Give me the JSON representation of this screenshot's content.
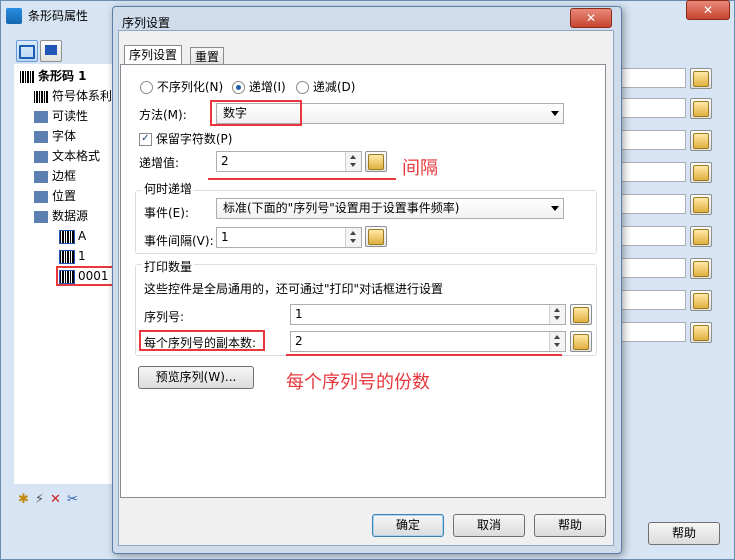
{
  "outer": {
    "title": "条形码属性",
    "tree": [
      {
        "label": "条形码 1",
        "icon": "barcode-icon",
        "bold": true
      },
      {
        "label": "符号体系利",
        "icon": "barcode-icon"
      },
      {
        "label": "可读性",
        "icon": "digits-icon"
      },
      {
        "label": "字体",
        "icon": "font-icon"
      },
      {
        "label": "文本格式",
        "icon": "text-format-icon"
      },
      {
        "label": "边框",
        "icon": "border-icon"
      },
      {
        "label": "位置",
        "icon": "position-icon"
      },
      {
        "label": "数据源",
        "icon": "datasource-icon"
      },
      {
        "label": "A",
        "icon": "barcode-source-icon"
      },
      {
        "label": "1",
        "icon": "barcode-source-icon"
      },
      {
        "label": "0001",
        "icon": "barcode-source-icon"
      }
    ],
    "help_button": "帮助",
    "close_glyph": "✕"
  },
  "dialog": {
    "title": "序列设置",
    "close_glyph": "✕",
    "tabs": [
      "序列设置",
      "重置"
    ],
    "radio_options": [
      "不序列化(N)",
      "递增(I)",
      "递减(D)"
    ],
    "method_label": "方法(M):",
    "method_value": "数字",
    "keep_chars_label": "保留字符数(P)",
    "increment_label": "递增值:",
    "increment_value": "2",
    "when_group_title": "何时递增",
    "event_label": "事件(E):",
    "event_value": "标准(下面的\"序列号\"设置用于设置事件频率)",
    "event_interval_label": "事件间隔(V):",
    "event_interval_value": "1",
    "print_group_title": "打印数量",
    "print_group_desc": "这些控件是全局通用的，还可通过\"打印\"对话框进行设置",
    "serial_label": "序列号:",
    "serial_value": "1",
    "copies_label": "每个序列号的副本数:",
    "copies_value": "2",
    "preview_button": "预览序列(W)...",
    "ok_button": "确定",
    "cancel_button": "取消",
    "help_button": "帮助"
  },
  "annotations": {
    "interval": "间隔",
    "copies": "每个序列号的份数"
  },
  "colors": {
    "annotation": "#e8383d",
    "title_bar": "#cfdcec"
  }
}
